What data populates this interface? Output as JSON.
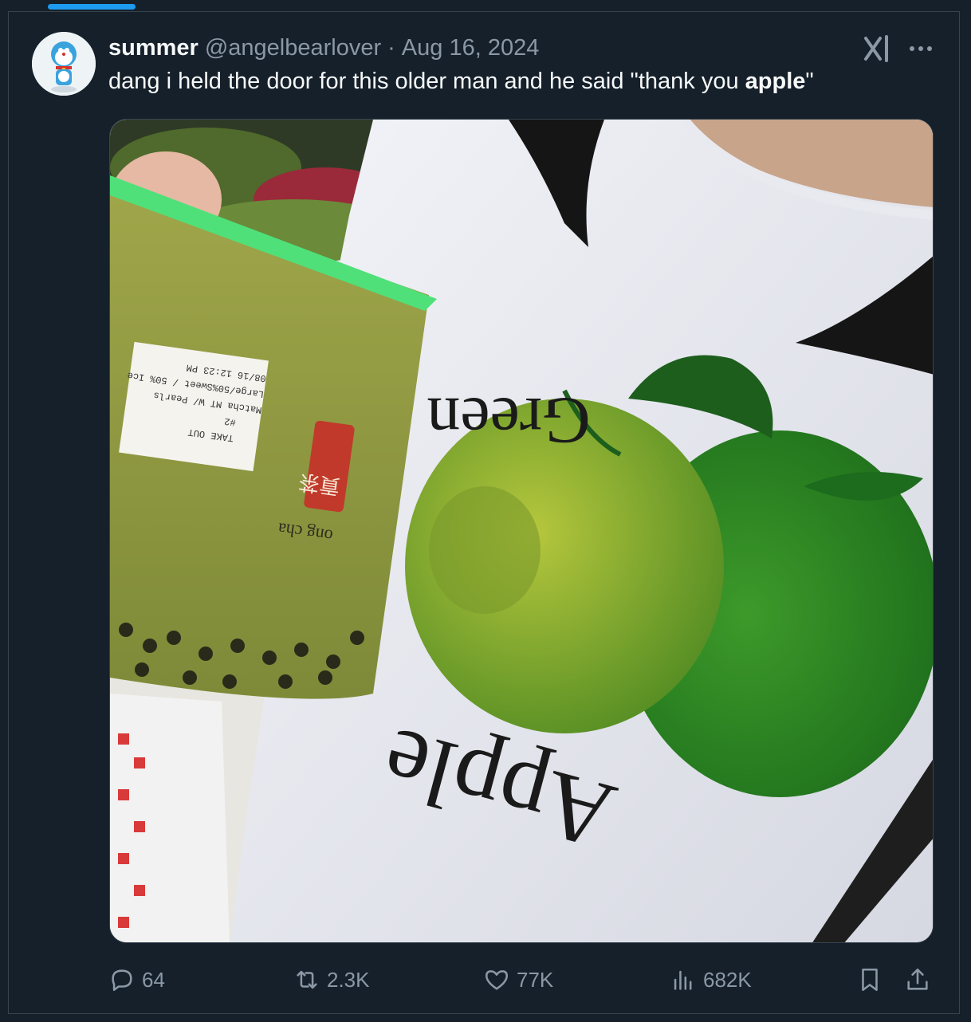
{
  "tweet": {
    "display_name": "summer",
    "handle": "@angelbearlover",
    "separator": "·",
    "date": "Aug 16, 2024",
    "text_before": "dang i held the door for this older man and he said \"thank you ",
    "text_bold": "apple",
    "text_after": "\""
  },
  "media": {
    "shirt_text_top": "Green",
    "shirt_text_bottom": "Apple",
    "cup_brand": "ong cha",
    "cup_chinese": "貢茶",
    "label_lines": [
      "TAKE OUT",
      "#2",
      "Matcha MT W/ Pearls",
      "Large/50%Sweet / 50% Ice",
      "08/16 12:23 PM"
    ]
  },
  "actions": {
    "replies": "64",
    "reposts": "2.3K",
    "likes": "77K",
    "views": "682K"
  },
  "colors": {
    "background": "#15202b",
    "muted": "#8b98a5",
    "accent": "#1d9bf0",
    "text": "#f7f9f9"
  },
  "icons": [
    "grok-icon",
    "more-icon",
    "reply-icon",
    "repost-icon",
    "like-icon",
    "views-icon",
    "bookmark-icon",
    "share-icon"
  ]
}
